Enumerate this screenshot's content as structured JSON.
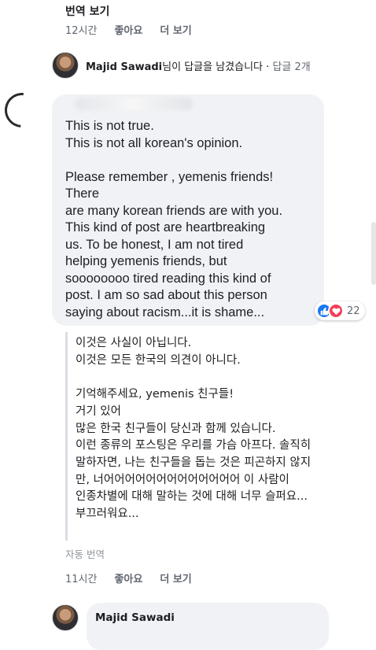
{
  "top": {
    "see_translation": "번역 보기",
    "time": "12시간",
    "like": "좋아요",
    "more": "더 보기"
  },
  "reply_summary": {
    "name": "Majid Sawadi",
    "text": "님이 답글을 남겼습니다 · ",
    "count": "답글 2개"
  },
  "comment": {
    "text": "This is not true.\nThis is not all korean's opinion.\n\nPlease remember , yemenis friends!\nThere\nare many korean friends are with you.\nThis kind of post are heartbreaking\nus. To be honest, I am not tired\nhelping yemenis friends, but\nsoooooooo tired reading this kind of\npost. I am so sad about this person\nsaying about racism...it is shame...",
    "reactions": {
      "count": "22",
      "types": [
        "like",
        "love"
      ]
    },
    "translation": "이것은 사실이 아닙니다.\n이것은 모든 한국의 의견이 아니다.\n\n기억해주세요, yemenis 친구들!\n거기 있어\n많은 한국 친구들이 당신과 함께 있습니다.\n이런 종류의 포스팅은 우리를 가슴 아프다. 솔직히\n말하자면, 나는 친구들을 돕는 것은 피곤하지 않지\n만, 너어어어어어어어어어어어어어 이 사람이\n인종차별에 대해 말하는 것에 대해 너무 슬퍼요...\n부끄러워요...",
    "auto_translation": "자동 번역",
    "time": "11시간",
    "like": "좋아요",
    "more": "더 보기"
  },
  "next_comment": {
    "name": "Majid Sawadi"
  },
  "colors": {
    "bubble": "#f0f2f5",
    "like": "#1877f2",
    "love": "#f33e58",
    "meta_text": "#606770"
  }
}
